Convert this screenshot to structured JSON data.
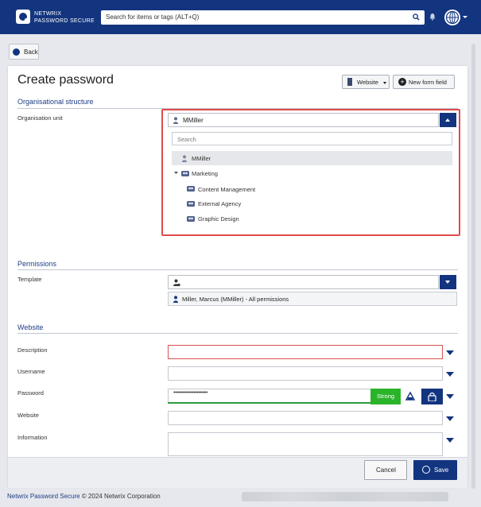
{
  "brand": {
    "line1": "NETWRIX",
    "line2": "PASSWORD SECURE"
  },
  "search": {
    "placeholder": "Search for items or tags (ALT+Q)"
  },
  "nav": {
    "back_label": "Back"
  },
  "page": {
    "title": "Create password"
  },
  "toolbar": {
    "website_label": "Website",
    "new_form_field_label": "New form field"
  },
  "sections": {
    "org_structure": "Organisational structure",
    "permissions": "Permissions",
    "website": "Website"
  },
  "org_unit": {
    "label": "Organisation unit",
    "value": "MMiller",
    "search_placeholder": "Search",
    "items": [
      {
        "label": "MMiller",
        "type": "user",
        "selected": true
      },
      {
        "label": "Marketing",
        "type": "group",
        "expanded": true
      },
      {
        "label": "Content Management",
        "type": "group"
      },
      {
        "label": "External Agency",
        "type": "group"
      },
      {
        "label": "Graphic Design",
        "type": "group"
      }
    ]
  },
  "permissions": {
    "template_label": "Template",
    "entry": "Miller, Marcus (MMiller) - All permissions"
  },
  "form": {
    "description_label": "Description",
    "username_label": "Username",
    "password_label": "Password",
    "password_masked": "••••••••••••••••••••••",
    "strength": "Strong",
    "website_label": "Website",
    "information_label": "Information"
  },
  "actions": {
    "cancel": "Cancel",
    "save": "Save"
  },
  "footer": {
    "product": "Netwrix Password Secure",
    "copyright": " © 2024 Netwrix Corporation"
  },
  "colors": {
    "brand_navy": "#13357f",
    "strength_green": "#2ab42a",
    "highlight_red": "#e04b4b"
  }
}
